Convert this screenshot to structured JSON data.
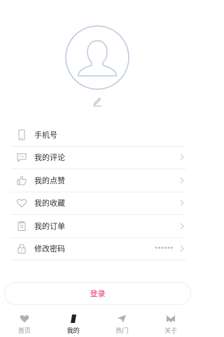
{
  "menu": {
    "items": [
      {
        "label": "手机号",
        "icon": "phone-icon"
      },
      {
        "label": "我的评论",
        "icon": "comment-icon"
      },
      {
        "label": "我的点赞",
        "icon": "thumbs-up-icon"
      },
      {
        "label": "我的收藏",
        "icon": "heart-icon"
      },
      {
        "label": "我的订单",
        "icon": "clipboard-icon"
      },
      {
        "label": "修改密码",
        "icon": "lock-icon",
        "value": "******"
      }
    ]
  },
  "login_label": "登录",
  "tabs": [
    {
      "label": "首页",
      "icon": "heart-icon",
      "active": false
    },
    {
      "label": "我的",
      "icon": "slash-icon",
      "active": true
    },
    {
      "label": "热门",
      "icon": "send-icon",
      "active": false
    },
    {
      "label": "关于",
      "icon": "m-logo-icon",
      "active": false
    }
  ],
  "colors": {
    "accent": "#e5336a",
    "icon": "#a9b0bc",
    "avatar": "#b9c9dc"
  }
}
